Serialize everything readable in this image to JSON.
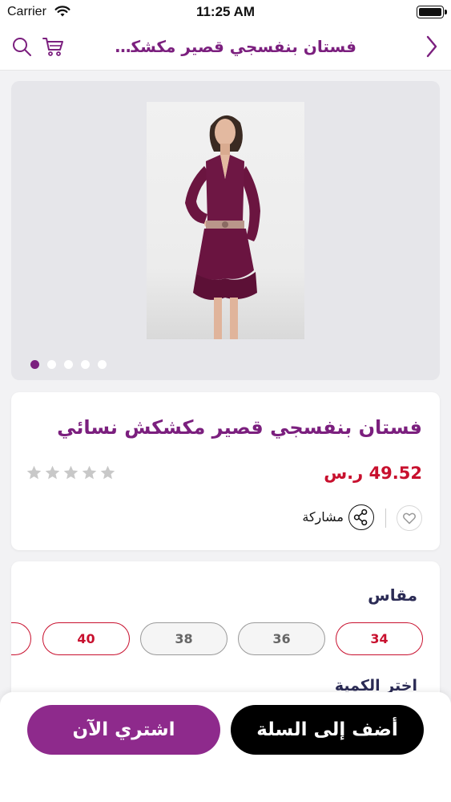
{
  "status_bar": {
    "carrier": "Carrier",
    "time": "11:25 AM"
  },
  "nav": {
    "title": "فستان بنفسجي قصير مكشكش نسائي",
    "icons": [
      "search-icon",
      "cart-icon",
      "chevron-right-icon"
    ]
  },
  "gallery": {
    "image_count": 5,
    "active_index": 0
  },
  "product": {
    "title": "فستان بنفسجي قصير مكشكش نسائي",
    "price": "49.52 ر.س",
    "rating": 0,
    "rating_max": 5,
    "share_label": "مشاركة"
  },
  "size_section": {
    "label": "مقاس",
    "options": [
      {
        "label": "34",
        "available": true
      },
      {
        "label": "36",
        "available": false
      },
      {
        "label": "38",
        "available": false
      },
      {
        "label": "40",
        "available": true
      }
    ]
  },
  "quantity_section": {
    "label": "اختر الكمية"
  },
  "actions": {
    "add_to_cart": "أضف إلى السلة",
    "buy_now": "اشتري الآن"
  },
  "colors": {
    "brand": "#7b1f7e",
    "price": "#c8102e",
    "buy_button": "#8e2a8c",
    "cart_button": "#000000"
  }
}
